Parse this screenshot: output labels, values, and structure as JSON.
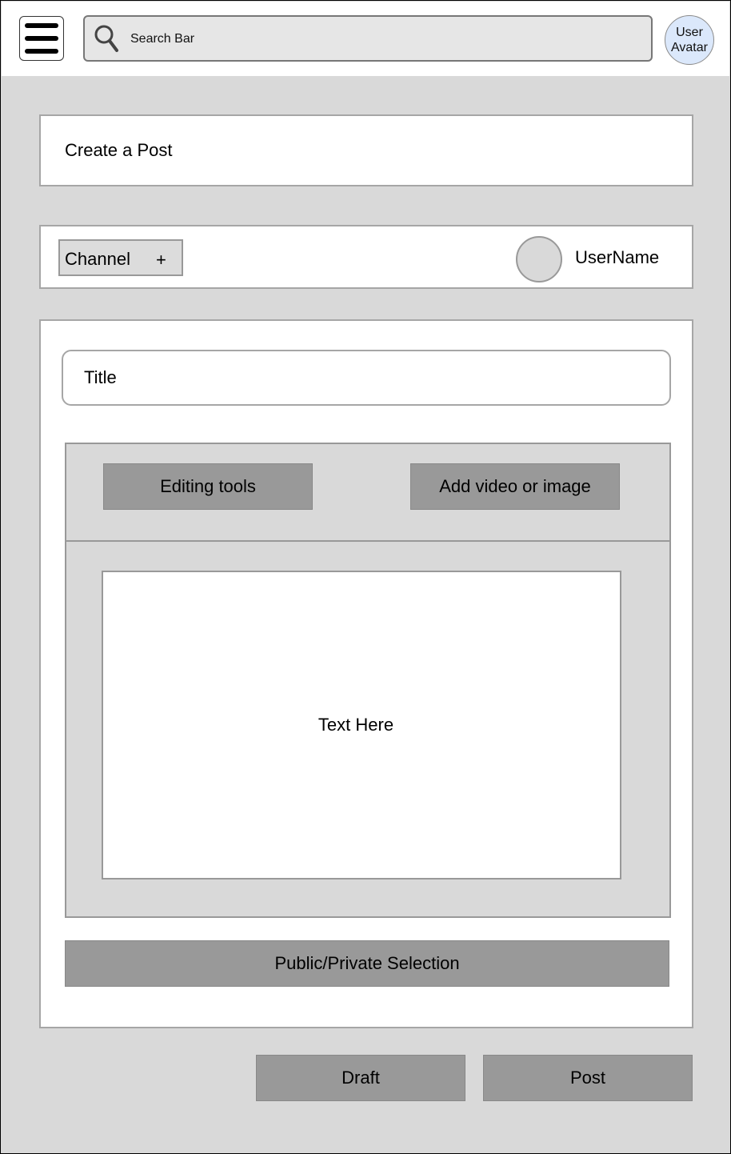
{
  "header": {
    "search_placeholder": "Search Bar",
    "avatar_line1": "User",
    "avatar_line2": "Avatar"
  },
  "page": {
    "title": "Create a Post"
  },
  "post_meta": {
    "channel_label": "Channel",
    "channel_add": "+",
    "username": "UserName"
  },
  "editor": {
    "title_placeholder": "Title",
    "editing_tools_label": "Editing tools",
    "add_media_label": "Add video or image",
    "body_placeholder": "Text Here",
    "visibility_label": "Public/Private Selection"
  },
  "actions": {
    "draft_label": "Draft",
    "post_label": "Post"
  },
  "icons": {
    "menu": "hamburger-menu-icon",
    "search": "search-icon"
  },
  "colors": {
    "background": "#d9d9d9",
    "button_gray": "#999999",
    "avatar_fill": "#dbe8fb"
  }
}
